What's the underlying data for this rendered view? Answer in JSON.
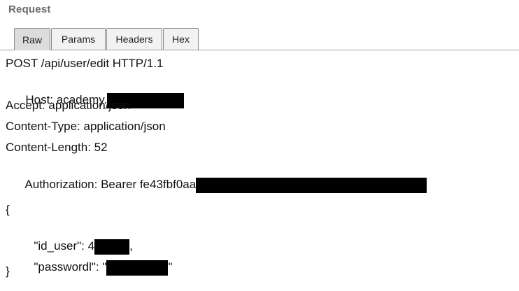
{
  "panel": {
    "title": "Request"
  },
  "tabs": [
    {
      "label": "Raw",
      "active": true
    },
    {
      "label": "Params",
      "active": false
    },
    {
      "label": "Headers",
      "active": false
    },
    {
      "label": "Hex",
      "active": false
    }
  ],
  "request": {
    "request_line": "POST /api/user/edit HTTP/1.1",
    "host_prefix": "Host: academy.",
    "accept": "Accept: application/json",
    "content_type": "Content-Type: application/json",
    "content_length": "Content-Length: 52",
    "authorization_prefix": "Authorization: Bearer fe43fbf0aa",
    "body_open": "{",
    "id_user_prefix": "\"id_user\": 4",
    "id_user_suffix": ",",
    "password_prefix": "\"passwordl\": \"",
    "password_suffix": "\"",
    "body_close": "}"
  },
  "colors": {
    "redaction": "#000000",
    "active_tab": "#dcdcdc"
  }
}
